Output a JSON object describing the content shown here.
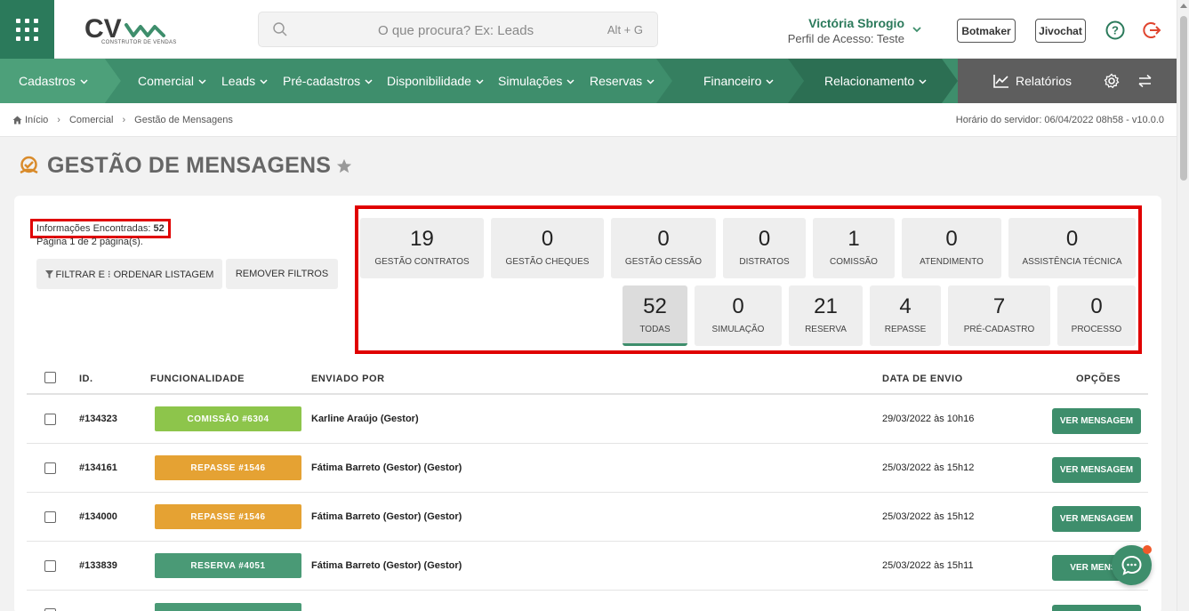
{
  "header": {
    "logo_text": "CV",
    "logo_sub": "CONSTRUTOR DE VENDAS",
    "search_placeholder": "O que procura? Ex: Leads",
    "search_shortcut": "Alt + G",
    "user_name": "Victória Sbrogio",
    "user_profile": "Perfil de Acesso: Teste",
    "botmaker_label": "Botmaker",
    "jivochat_label": "Jivochat"
  },
  "nav": {
    "cadastros": "Cadastros",
    "comercial": "Comercial",
    "leads": "Leads",
    "precadastros": "Pré-cadastros",
    "disponibilidade": "Disponibilidade",
    "simulacoes": "Simulações",
    "reservas": "Reservas",
    "financeiro": "Financeiro",
    "relacionamento": "Relacionamento",
    "relatorios": "Relatórios"
  },
  "breadcrumb": {
    "home": "Início",
    "comercial": "Comercial",
    "current": "Gestão de Mensagens",
    "server_time": "Horário do servidor: 06/04/2022 08h58 - v10.0.0"
  },
  "page": {
    "title": "GESTÃO DE MENSAGENS",
    "found_label": "Informações Encontradas:",
    "found_count": "52",
    "pages_text": "Página 1 de 2 página(s).",
    "filter_button": "FILTRAR E ⁝ ORDENAR LISTAGEM",
    "remove_filters_button": "REMOVER FILTROS"
  },
  "stats_row1": [
    {
      "value": "19",
      "label": "Gestão Contratos"
    },
    {
      "value": "0",
      "label": "Gestão Cheques"
    },
    {
      "value": "0",
      "label": "Gestão Cessão"
    },
    {
      "value": "0",
      "label": "Distratos"
    },
    {
      "value": "1",
      "label": "Comissão"
    },
    {
      "value": "0",
      "label": "Atendimento"
    },
    {
      "value": "0",
      "label": "Assistência Técnica"
    }
  ],
  "stats_row2": [
    {
      "value": "52",
      "label": "Todas"
    },
    {
      "value": "0",
      "label": "Simulação"
    },
    {
      "value": "21",
      "label": "Reserva"
    },
    {
      "value": "4",
      "label": "Repasse"
    },
    {
      "value": "7",
      "label": "Pré-cadastro"
    },
    {
      "value": "0",
      "label": "Processo"
    }
  ],
  "table": {
    "headers": {
      "id": "ID.",
      "feature": "FUNCIONALIDADE",
      "sent_by": "ENVIADO POR",
      "date": "DATA DE ENVIO",
      "options": "OPÇÕES"
    },
    "rows": [
      {
        "id": "#134323",
        "tag": "COMISSÃO #6304",
        "tag_color": "#8dc54b",
        "sent_by": "Karline Araújo (Gestor)",
        "date": "29/03/2022 às 10h16",
        "action": "VER MENSAGEM"
      },
      {
        "id": "#134161",
        "tag": "REPASSE #1546",
        "tag_color": "#e5a233",
        "sent_by": "Fátima Barreto (Gestor) (Gestor)",
        "date": "25/03/2022 às 15h12",
        "action": "VER MENSAGEM"
      },
      {
        "id": "#134000",
        "tag": "REPASSE #1546",
        "tag_color": "#e5a233",
        "sent_by": "Fátima Barreto (Gestor) (Gestor)",
        "date": "25/03/2022 às 15h12",
        "action": "VER MENSAGEM"
      },
      {
        "id": "#133839",
        "tag": "RESERVA #4051",
        "tag_color": "#4a9a76",
        "sent_by": "Fátima Barreto (Gestor) (Gestor)",
        "date": "25/03/2022 às 15h11",
        "action": "VER MENSA"
      }
    ]
  },
  "colors": {
    "brand": "#3e8e6c",
    "highlight": "#e00000"
  }
}
